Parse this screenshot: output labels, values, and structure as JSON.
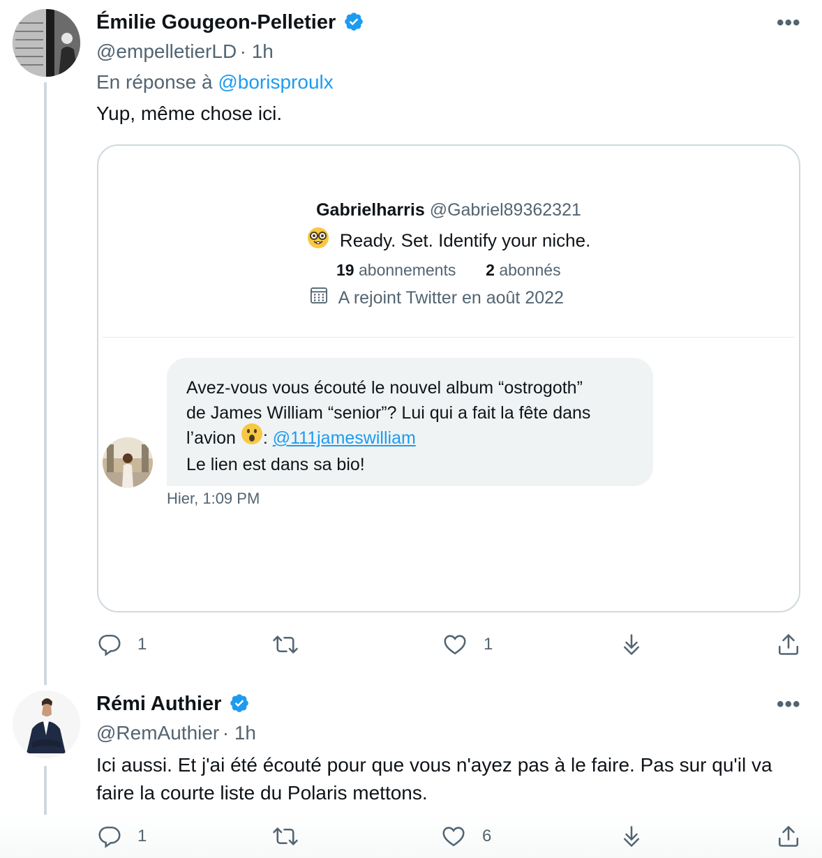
{
  "tweets": [
    {
      "name": "Émilie Gougeon-Pelletier",
      "handle": "@empelletierLD",
      "time": "· 1h",
      "reply_prefix": "En réponse à",
      "reply_to": "@borisproulx",
      "text": "Yup, même chose ici.",
      "more": "•••",
      "actions": {
        "replies": "1",
        "retweets": "",
        "likes": "1"
      }
    },
    {
      "name": "Rémi Authier",
      "handle": "@RemAuthier",
      "time": "· 1h",
      "text": "Ici aussi. Et j'ai été écouté pour que vous n'ayez pas à le faire. Pas sur qu'il va faire la courte liste du Polaris mettons.",
      "more": "•••",
      "actions": {
        "replies": "1",
        "retweets": "",
        "likes": "6"
      }
    }
  ],
  "card": {
    "profile": {
      "name": "Gabrielharris",
      "handle": "@Gabriel89362321",
      "bio": "Ready. Set. Identify your niche.",
      "following_count": "19",
      "following_label": "abonnements",
      "followers_count": "2",
      "followers_label": "abonnés",
      "joined": "A rejoint Twitter en août 2022"
    },
    "message": {
      "line1": "Avez-vous vous écouté le nouvel album “ostrogoth”",
      "line2": "de James William “senior”? Lui qui a fait la fête dans",
      "line3_prefix": "l’avion",
      "line3_sep": ":",
      "mention": "@111jameswilliam",
      "line4": "Le lien est dans sa bio!",
      "timestamp": "Hier, 1:09 PM"
    }
  },
  "colors": {
    "accent": "#1d9bf0",
    "secondary_text": "#536471",
    "border": "#cfd9de",
    "bubble": "#eff3f4"
  },
  "icons": [
    "verified-badge-icon",
    "more-icon",
    "reply-icon",
    "retweet-icon",
    "like-icon",
    "download-icon",
    "share-icon",
    "calendar-icon",
    "nerd-face-emoji",
    "surprised-face-emoji"
  ]
}
